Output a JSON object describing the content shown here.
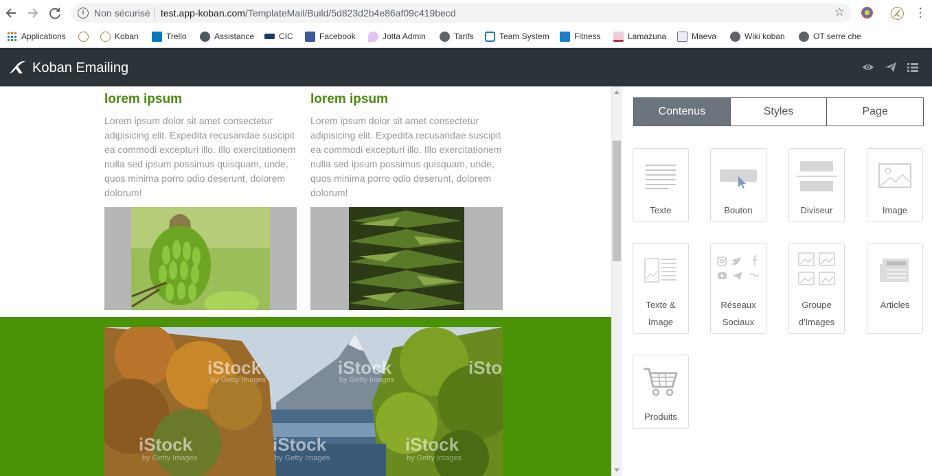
{
  "browser": {
    "security_label": "Non sécurisé",
    "url_host": "test.app-koban.com",
    "url_path": "/TemplateMail/Build/5d823d2b4e86af09c419becd",
    "menu_glyph": "⋮",
    "icons": [
      "back-icon",
      "forward-icon",
      "reload-icon",
      "info-icon",
      "star-icon",
      "menu-icon"
    ]
  },
  "bookmarks": [
    {
      "label": "Applications",
      "icon": "apps-grid-icon",
      "color": "#e8710a"
    },
    {
      "label": "",
      "icon": "koban-icon",
      "color": "#b08a4a"
    },
    {
      "label": "Koban",
      "icon": "koban-icon",
      "color": "#b08a4a"
    },
    {
      "label": "Trello",
      "icon": "trello-icon",
      "color": "#0079bf"
    },
    {
      "label": "Assistance",
      "icon": "headset-icon",
      "color": "#4a5a66"
    },
    {
      "label": "CIC",
      "icon": "cic-icon",
      "color": "#1b3a6b"
    },
    {
      "label": "Facebook",
      "icon": "facebook-icon",
      "color": "#3b5998"
    },
    {
      "label": "Jotta Admin",
      "icon": "jotta-icon",
      "color": "#d3a6e0"
    },
    {
      "label": "Tarifs",
      "icon": "globe-icon",
      "color": "#5f6368"
    },
    {
      "label": "Team System",
      "icon": "team-system-icon",
      "color": "#1a73c9"
    },
    {
      "label": "Fitness",
      "icon": "fitness-icon",
      "color": "#1a7fc9"
    },
    {
      "label": "Lamazuna",
      "icon": "lamazuna-icon",
      "color": "#b0304a"
    },
    {
      "label": "Maeva",
      "icon": "maeva-icon",
      "color": "#7a6a9a"
    },
    {
      "label": "Wiki koban",
      "icon": "globe-icon",
      "color": "#5f6368"
    },
    {
      "label": "OT serre che",
      "icon": "globe-icon",
      "color": "#5f6368"
    }
  ],
  "app": {
    "title": "Koban Emailing",
    "header_icons": [
      "preview-eye-icon",
      "send-icon",
      "list-menu-icon"
    ]
  },
  "email": {
    "columns": [
      {
        "heading": "lorem ipsum",
        "text": "Lorem ipsum dolor sit amet consectetur adipisicing elit. Expedita recusandae suscipit ea commodi excepturi illo. Illo exercitationem nulla sed ipsum possimus quisquam, unde, quos minima porro odio deserunt, dolorem dolorum!",
        "image": "pine-cone-photo"
      },
      {
        "heading": "lorem ipsum",
        "text": "Lorem ipsum dolor sit amet consectetur adipisicing elit. Expedita recusandae suscipit ea commodi excepturi illo. Illo exercitationem nulla sed ipsum possimus quisquam, unde, quos minima porro odio deserunt, dolorem dolorum!",
        "image": "fir-tree-photo"
      }
    ],
    "banner_image": "autumn-lake-photo",
    "watermark": "iStock",
    "watermark_sub": "by Getty Images",
    "accent_color": "#4a8a0b",
    "band_color": "#4b9206"
  },
  "panel": {
    "tabs": [
      "Contenus",
      "Styles",
      "Page"
    ],
    "active_tab": "Contenus",
    "blocks": [
      {
        "label": "Texte",
        "icon": "text-block-icon"
      },
      {
        "label": "Bouton",
        "icon": "button-block-icon"
      },
      {
        "label": "Diviseur",
        "icon": "divider-block-icon"
      },
      {
        "label": "Image",
        "icon": "image-block-icon"
      },
      {
        "label": "Texte &",
        "label2": "Image",
        "icon": "text-image-block-icon"
      },
      {
        "label": "Réseaux",
        "label2": "Sociaux",
        "icon": "social-block-icon"
      },
      {
        "label": "Groupe",
        "label2": "d'Images",
        "icon": "image-group-block-icon"
      },
      {
        "label": "Articles",
        "icon": "articles-block-icon"
      },
      {
        "label": "Produits",
        "icon": "cart-block-icon"
      }
    ]
  }
}
